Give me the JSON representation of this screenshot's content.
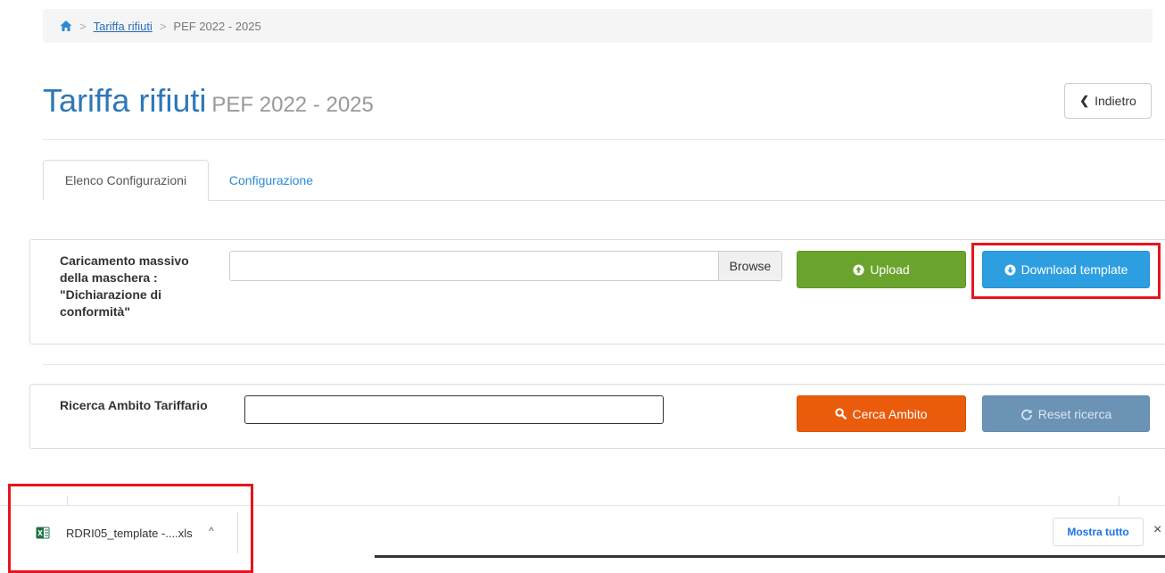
{
  "breadcrumb": {
    "home_icon": "home-icon",
    "separator": ">",
    "link": "Tariffa rifiuti",
    "current": "PEF 2022 - 2025"
  },
  "header": {
    "title": "Tariffa rifiuti",
    "subtitle": "PEF 2022 - 2025",
    "back_label": "Indietro",
    "back_icon": "chevron-left-icon"
  },
  "tabs": [
    {
      "label": "Elenco Configurazioni",
      "active": true
    },
    {
      "label": "Configurazione",
      "active": false
    }
  ],
  "upload_panel": {
    "label": "Caricamento massivo della maschera : \"Dichiarazione di conformità\"",
    "file_value": "",
    "browse_label": "Browse",
    "upload_label": "Upload",
    "upload_icon": "circle-up-icon",
    "download_label": "Download template",
    "download_icon": "circle-down-icon"
  },
  "search_panel": {
    "label": "Ricerca Ambito Tariffario",
    "search_value": "",
    "search_label": "Cerca Ambito",
    "search_icon": "search-icon",
    "reset_label": "Reset ricerca",
    "reset_icon": "refresh-icon"
  },
  "download_bar": {
    "filename": "RDRI05_template -....xls",
    "file_icon": "excel-file-icon",
    "caret": "^",
    "show_all_label": "Mostra tutto",
    "close": "×"
  },
  "colors": {
    "title": "#2e78b7",
    "upload_button": "#6aa42c",
    "download_button": "#2d9fe0",
    "search_button": "#ea5b0c",
    "reset_button": "#6b93b6",
    "highlight": "#e8141c"
  }
}
